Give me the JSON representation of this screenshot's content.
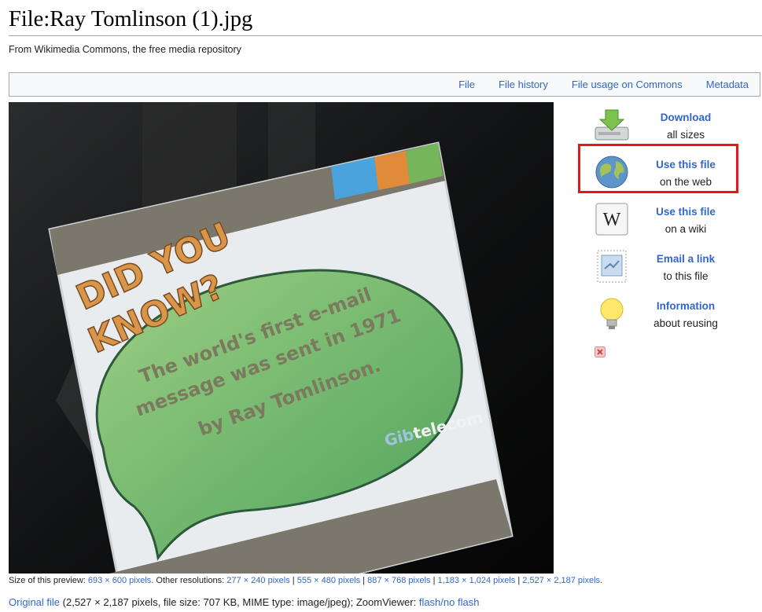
{
  "page": {
    "title": "File:Ray Tomlinson (1).jpg",
    "tagline": "From Wikimedia Commons, the free media repository"
  },
  "filetoc": {
    "links": [
      "File",
      "File history",
      "File usage on Commons",
      "Metadata"
    ]
  },
  "preview_card": {
    "heading_line1": "DID YOU",
    "heading_line2": "KNOW?",
    "message_line1": "The world's first e-mail",
    "message_line2": "message was sent in 1971",
    "message_line3": "by Ray Tomlinson.",
    "brand_prefix": "Gib",
    "brand_suffix": "telecom"
  },
  "sidebar": {
    "download": {
      "label": "Download",
      "sub": "all sizes",
      "icon": "download-drive-icon"
    },
    "use_web": {
      "label": "Use this file",
      "sub": "on the web",
      "icon": "globe-icon"
    },
    "use_wiki": {
      "label": "Use this file",
      "sub": "on a wiki",
      "icon": "wikipedia-w-icon"
    },
    "email": {
      "label": "Email a link",
      "sub": "to this file",
      "icon": "envelope-stamp-icon"
    },
    "info": {
      "label": "Information",
      "sub": "about reusing",
      "icon": "lightbulb-icon"
    },
    "highlight_color": "#e8161b"
  },
  "size_info": {
    "prefix": "Size of this preview: ",
    "preview_link": "693 × 600 pixels",
    "middle": ". Other resolutions: ",
    "resolutions": [
      "277 × 240 pixels",
      "555 × 480 pixels",
      "887 × 768 pixels",
      "1,183 × 1,024 pixels",
      "2,527 × 2,187 pixels"
    ],
    "separator": " | ",
    "suffix": "."
  },
  "original_file": {
    "link": "Original file",
    "details": " (2,527 × 2,187 pixels, file size: 707 KB, MIME type: image/jpeg); ZoomViewer: ",
    "zoom_link": "flash/no flash"
  }
}
